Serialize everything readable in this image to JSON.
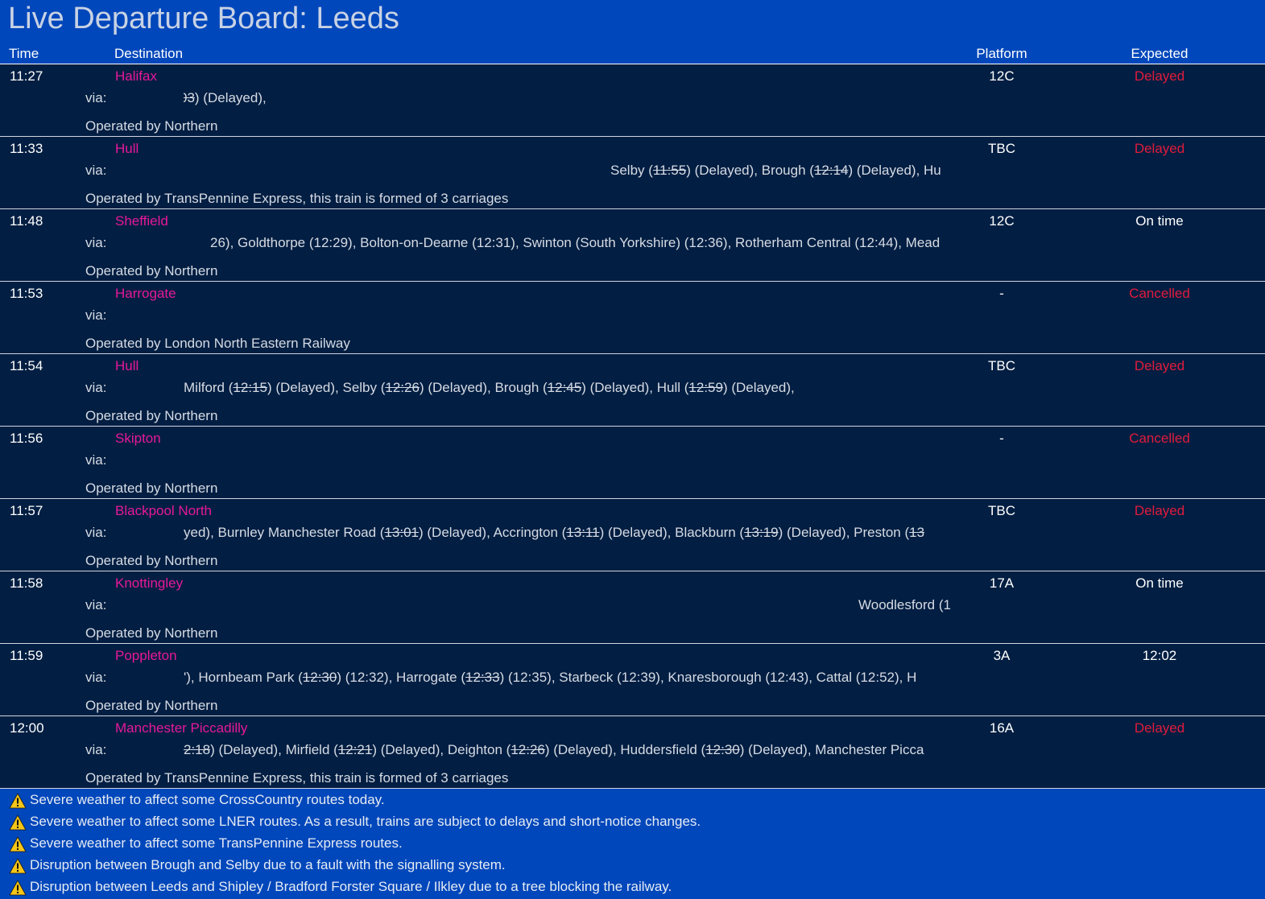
{
  "header": {
    "title": "Live Departure Board: Leeds",
    "columns": {
      "time": "Time",
      "destination": "Destination",
      "platform": "Platform",
      "expected": "Expected"
    }
  },
  "via_label": "via:",
  "departures": [
    {
      "time": "11:27",
      "destination": "Halifax",
      "platform": "12C",
      "expected": "Delayed",
      "status": "delayed",
      "via_segments": [
        {
          "t": "03",
          "struck": true
        },
        {
          "t": ") (Delayed),",
          "struck": false
        }
      ],
      "operator": "Operated by Northern"
    },
    {
      "time": "11:33",
      "destination": "Hull",
      "platform": "TBC",
      "expected": "Delayed",
      "status": "delayed",
      "via_segments": [
        {
          "t": "Selby (",
          "struck": false
        },
        {
          "t": "11:55",
          "struck": true
        },
        {
          "t": ") (Delayed), Brough (",
          "struck": false
        },
        {
          "t": "12:14",
          "struck": true
        },
        {
          "t": ") (Delayed), Hu",
          "struck": false
        }
      ],
      "operator": "Operated by TransPennine Express, this train is formed of 3 carriages"
    },
    {
      "time": "11:48",
      "destination": "Sheffield",
      "platform": "12C",
      "expected": "On time",
      "status": "ontime",
      "via_segments": [
        {
          "t": "26), Goldthorpe (12:29), Bolton-on-Dearne (12:31), Swinton (South Yorkshire) (12:36), Rotherham Central (12:44), Mead",
          "struck": false
        }
      ],
      "operator": "Operated by Northern"
    },
    {
      "time": "11:53",
      "destination": "Harrogate",
      "platform": "-",
      "expected": "Cancelled",
      "status": "cancelled",
      "via_segments": [],
      "operator": "Operated by London North Eastern Railway"
    },
    {
      "time": "11:54",
      "destination": "Hull",
      "platform": "TBC",
      "expected": "Delayed",
      "status": "delayed",
      "via_segments": [
        {
          "t": "Milford (",
          "struck": false
        },
        {
          "t": "12:15",
          "struck": true
        },
        {
          "t": ") (Delayed), Selby (",
          "struck": false
        },
        {
          "t": "12:26",
          "struck": true
        },
        {
          "t": ") (Delayed), Brough (",
          "struck": false
        },
        {
          "t": "12:45",
          "struck": true
        },
        {
          "t": ") (Delayed), Hull (",
          "struck": false
        },
        {
          "t": "12:59",
          "struck": true
        },
        {
          "t": ") (Delayed),",
          "struck": false
        }
      ],
      "operator": "Operated by Northern"
    },
    {
      "time": "11:56",
      "destination": "Skipton",
      "platform": "-",
      "expected": "Cancelled",
      "status": "cancelled",
      "via_segments": [],
      "operator": "Operated by Northern"
    },
    {
      "time": "11:57",
      "destination": "Blackpool North",
      "platform": "TBC",
      "expected": "Delayed",
      "status": "delayed",
      "via_segments": [
        {
          "t": "yed), Burnley Manchester Road (",
          "struck": false
        },
        {
          "t": "13:01",
          "struck": true
        },
        {
          "t": ") (Delayed), Accrington (",
          "struck": false
        },
        {
          "t": "13:11",
          "struck": true
        },
        {
          "t": ") (Delayed), Blackburn (",
          "struck": false
        },
        {
          "t": "13:19",
          "struck": true
        },
        {
          "t": ") (Delayed), Preston (",
          "struck": false
        },
        {
          "t": "13",
          "struck": true
        }
      ],
      "operator": "Operated by Northern"
    },
    {
      "time": "11:58",
      "destination": "Knottingley",
      "platform": "17A",
      "expected": "On time",
      "status": "ontime",
      "via_segments": [
        {
          "t": "Woodlesford (1",
          "struck": false
        }
      ],
      "operator": "Operated by Northern"
    },
    {
      "time": "11:59",
      "destination": "Poppleton",
      "platform": "3A",
      "expected": "12:02",
      "status": "time",
      "via_segments": [
        {
          "t": "'), Hornbeam Park (",
          "struck": false
        },
        {
          "t": "12:30",
          "struck": true
        },
        {
          "t": ") (12:32), Harrogate (",
          "struck": false
        },
        {
          "t": "12:33",
          "struck": true
        },
        {
          "t": ") (12:35), Starbeck (12:39), Knaresborough (12:43), Cattal (12:52), H",
          "struck": false
        }
      ],
      "operator": "Operated by Northern"
    },
    {
      "time": "12:00",
      "destination": "Manchester Piccadilly",
      "platform": "16A",
      "expected": "Delayed",
      "status": "delayed",
      "via_segments": [
        {
          "t": "2:18",
          "struck": true
        },
        {
          "t": ") (Delayed), Mirfield (",
          "struck": false
        },
        {
          "t": "12:21",
          "struck": true
        },
        {
          "t": ") (Delayed), Deighton (",
          "struck": false
        },
        {
          "t": "12:26",
          "struck": true
        },
        {
          "t": ") (Delayed), Huddersfield (",
          "struck": false
        },
        {
          "t": "12:30",
          "struck": true
        },
        {
          "t": ") (Delayed), Manchester Picca",
          "struck": false
        }
      ],
      "operator": "Operated by TransPennine Express, this train is formed of 3 carriages"
    }
  ],
  "alerts": [
    {
      "icon": "warning-icon",
      "text": "Severe weather to affect some CrossCountry routes today."
    },
    {
      "icon": "warning-icon",
      "text": "Severe weather to affect some LNER routes. As a result, trains are subject to delays and short-notice changes."
    },
    {
      "icon": "warning-icon",
      "text": "Severe weather to affect some TransPennine Express routes."
    },
    {
      "icon": "warning-icon",
      "text": "Disruption between Brough and Selby due to a fault with the signalling system."
    },
    {
      "icon": "warning-icon",
      "text": "Disruption between Leeds and Shipley / Bradford Forster Square / Ilkley due to a tree blocking the railway."
    }
  ],
  "colors": {
    "header_bg": "#0047bb",
    "board_bg": "#021e42",
    "destination": "#e8189a",
    "status_alert": "#e11b3c",
    "warning_yellow": "#f5c518"
  }
}
